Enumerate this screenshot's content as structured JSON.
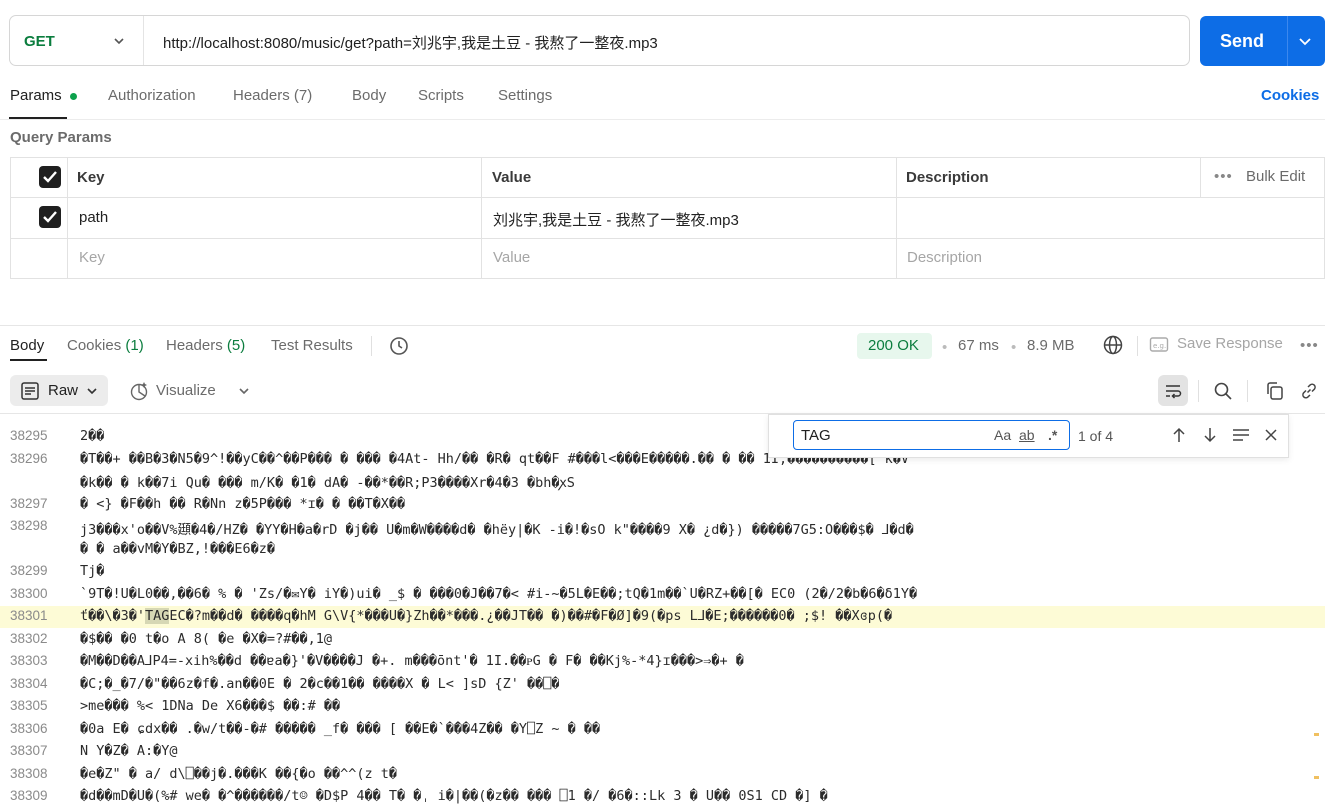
{
  "request": {
    "method": "GET",
    "url": "http://localhost:8080/music/get?path=刘兆宇,我是土豆 - 我熬了一整夜.mp3",
    "send_label": "Send"
  },
  "request_tabs": [
    {
      "label": "Params"
    },
    {
      "label": "Authorization"
    },
    {
      "label": "Headers (7)"
    },
    {
      "label": "Body"
    },
    {
      "label": "Scripts"
    },
    {
      "label": "Settings"
    }
  ],
  "cookies_link": "Cookies",
  "query_params": {
    "title": "Query Params",
    "headers": {
      "key": "Key",
      "value": "Value",
      "description": "Description",
      "bulk_edit": "Bulk Edit"
    },
    "rows": [
      {
        "checked": true,
        "key": "path",
        "value": "刘兆宇,我是土豆 - 我熬了一整夜.mp3",
        "description": ""
      }
    ],
    "placeholder": {
      "key": "Key",
      "value": "Value",
      "description": "Description"
    }
  },
  "response": {
    "tabs": {
      "body": "Body",
      "cookies": "Cookies",
      "cookies_count": "(1)",
      "headers": "Headers",
      "headers_count": "(5)",
      "test_results": "Test Results"
    },
    "status": "200 OK",
    "time": "67 ms",
    "size": "8.9 MB",
    "save_label": "Save Response",
    "format": "Raw",
    "visualize": "Visualize"
  },
  "find": {
    "query": "TAG",
    "count": "1 of 4",
    "opt_case": "Aa",
    "opt_word": "ab"
  },
  "code_lines": [
    {
      "num": "38295",
      "text": "2��"
    },
    {
      "num": "38296",
      "text": "�T��+  ��B�3�N5�9^!��yC��^��P���  �  ���  �4At- Hh/��  �R�  qt��F #���l<���E�����.��  �   ��    1I,����������[  k�V"
    },
    {
      "num": "",
      "text": "   �k��  �  k��7i  Qu�  ���   m/K�  �1�  dA�  -��*��R;P3����Xr�4�3  �bh�ꭗS"
    },
    {
      "num": "38297",
      "text": "�  <}  �F��h  ��  R�Nn  z�5P���  *ɪ�  �   ��T�X��"
    },
    {
      "num": "38298",
      "text": "j3���x'o��V%頲�4�/HZ�  �YY�H�a�rD  �j��  U�m�W����d�    �hëy|�K  -i�!�sO  k\"����9  X�  ¿d�}) �����7G5꞉O���$�  ⅃�d�"
    },
    {
      "num": "",
      "text": "   �  �  a��vM�Y�BZ,!���E6�z�"
    },
    {
      "num": "38299",
      "text": "Tj�"
    },
    {
      "num": "38300",
      "text": "`9T�!U�L0��,��6� %  �  'Zs/�✉Y�         iY�)ui�  _$  �  ���0�J��7�<  #i-~�5L�E��;tQ�1m��`U�RZ+��[�  EC0  (2�/2�b�6�δ1Y�"
    },
    {
      "num": "38301",
      "text": "  ť��\\�3�'TAGEC�?m��d�  ����q�hM  G\\V{*���U�}Zh��*���.¿��JT��  �)��#�F�Ø]�9(�ps  L⅃�E;������0�  ;$!  ��Xɞp(�"
    },
    {
      "num": "38302",
      "text": "�$�� �0  t�o     A  8(  �e  �X�=?#��,1@  "
    },
    {
      "num": "38303",
      "text": "  �M��D��A⅃P4=-xih%��d  ��ɐa�}'�V����J  �+.     m���ōnt'�  1I.��ᴘG  �  F�     ��Kj%-*4}ɪ���>⇒�+  �"
    },
    {
      "num": "38304",
      "text": "�C;�_�7/�\"��6z�f�.an��0E  �  2�c��1��  ����X     �  L<       ]sD  {Z'  ��⎕�"
    },
    {
      "num": "38305",
      "text": ">me���  %<    1DNa  De  X6���$  ��:#     ��"
    },
    {
      "num": "38306",
      "text": "�0a  E�  ɕdx��  .�w/t��-�#  �����  _f�  ���   [   ��E�`�̈��4Z��     �Y⎕Z   ~  �  ��"
    },
    {
      "num": "38307",
      "text": "N  Y�Z�  A:�Y@"
    },
    {
      "num": "38308",
      "text": "�e�Z\"  �  a/  d\\⎕��j�.���K  ��{�o  ��^^(z  t�"
    },
    {
      "num": "38309",
      "text": "�d��mD�U�(%#  we�  �^������/t☺     �D$P  4��  T� �ˌ i�|��(�z��  ���  ⎕1    �/  �6�::Lk  3    �  U��  0S1  CD  �]     �"
    }
  ],
  "colors": {
    "accent": "#0d6de6",
    "status_ok": "#0b7d3e",
    "control_char": "#a3150f",
    "highlight_line": "#fdfbd6"
  }
}
